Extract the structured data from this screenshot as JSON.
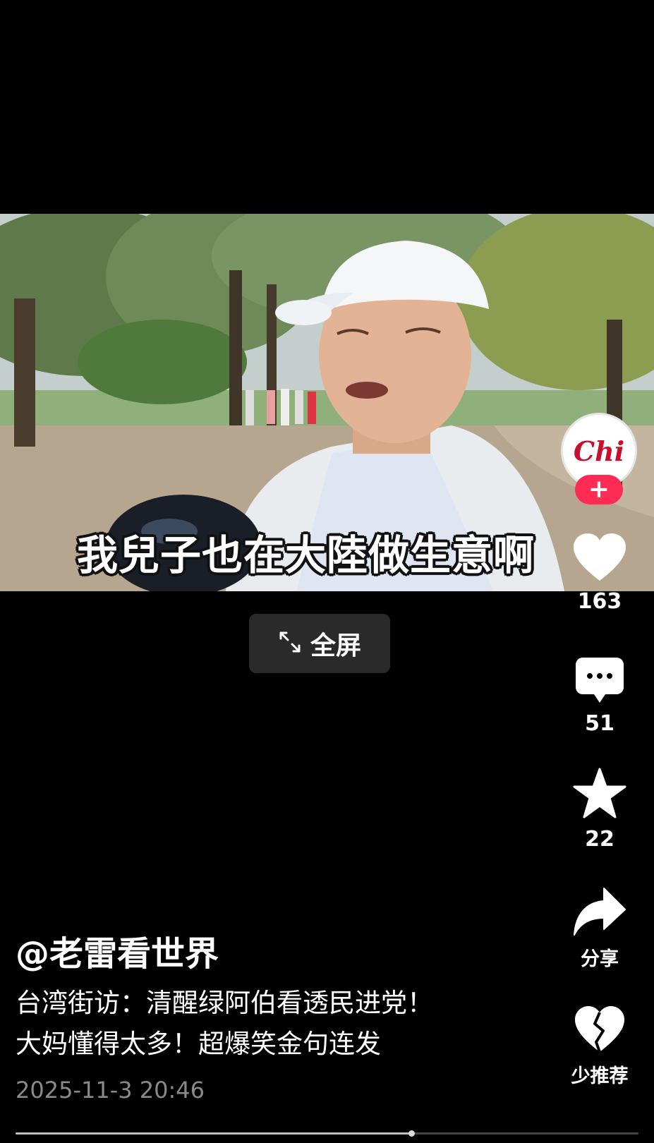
{
  "video": {
    "subtitle": "我兒子也在大陸做生意啊"
  },
  "fullscreen": {
    "label": "全屏",
    "icon": "expand-icon"
  },
  "author_avatar": {
    "text": "Chi",
    "follow_label": "+"
  },
  "actions": {
    "like": {
      "icon": "heart-icon",
      "count": "163"
    },
    "comment": {
      "icon": "comment-icon",
      "count": "51"
    },
    "favorite": {
      "icon": "star-icon",
      "count": "22"
    },
    "share": {
      "icon": "share-icon",
      "label": "分享"
    },
    "not_interested": {
      "icon": "broken-heart-icon",
      "label": "少推荐"
    }
  },
  "post": {
    "author": "@老雷看世界",
    "desc_line1": "台湾街访：清醒绿阿伯看透民进党！",
    "desc_line2": "大妈懂得太多！超爆笑金句连发",
    "date": "2025-11-3 20:46"
  },
  "playback": {
    "progress": 0.635
  },
  "colors": {
    "accent": "#fe2c55",
    "background": "#000000",
    "date_gray": "#8a8a8a"
  }
}
